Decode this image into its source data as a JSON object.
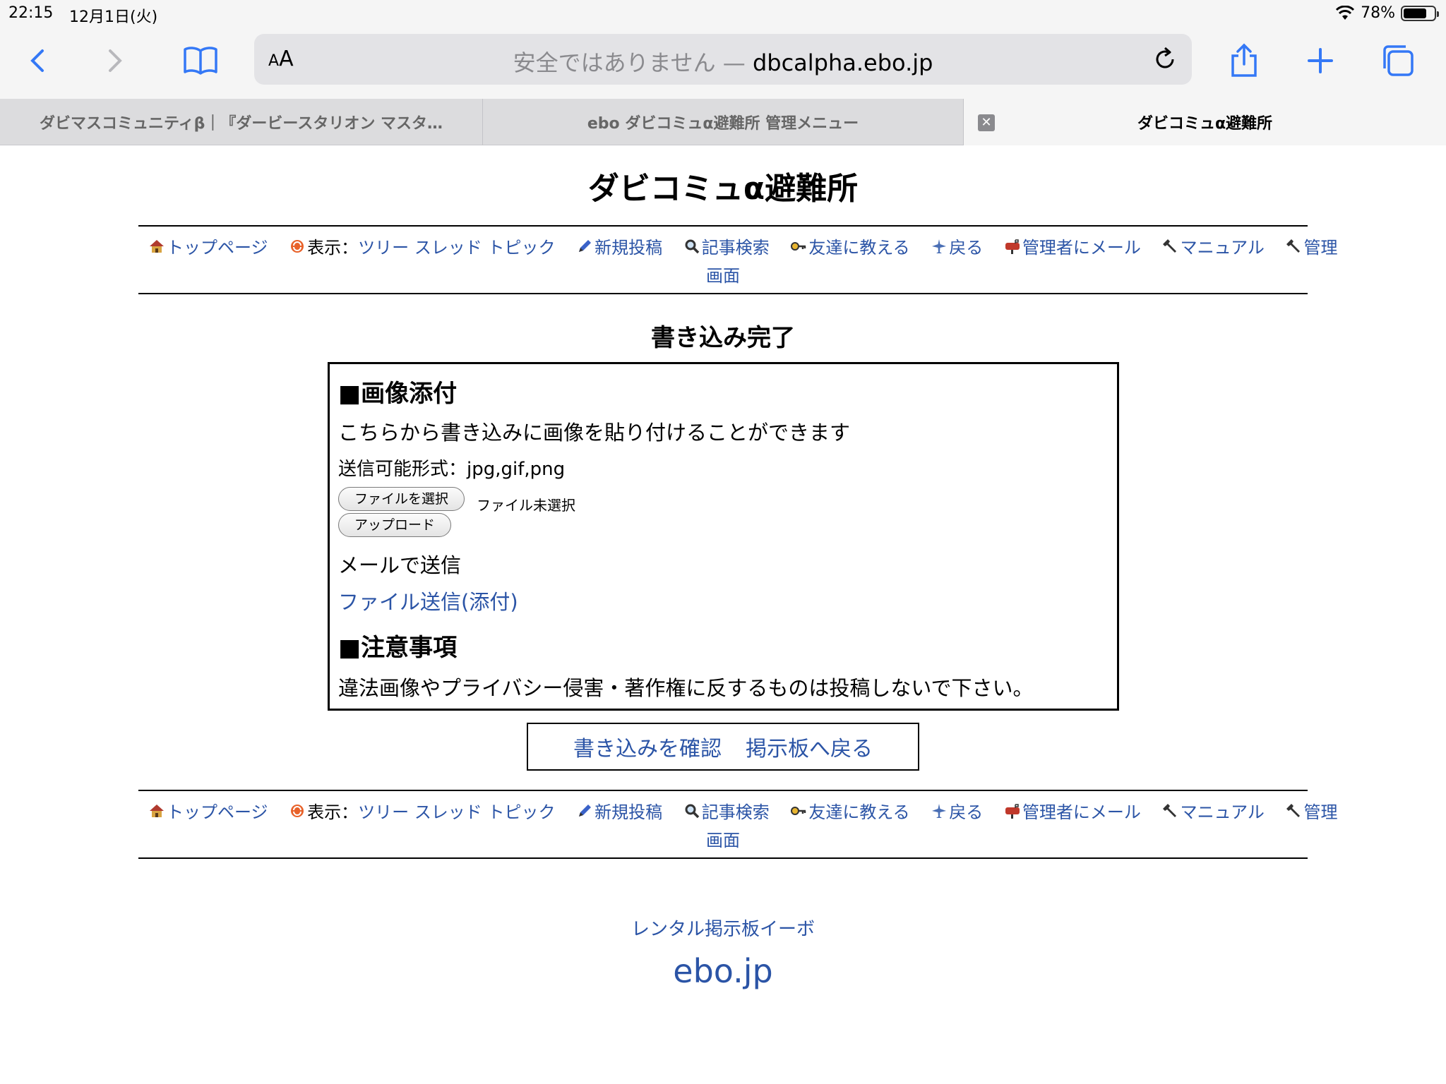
{
  "status_bar": {
    "time": "22:15",
    "date": "12月1日(火)",
    "battery": "78%",
    "battery_level": 0.78
  },
  "browser": {
    "text_size_label_small": "A",
    "text_size_label_large": "A",
    "address_insecure": "安全ではありません —",
    "address_host": "dbcalpha.ebo.jp",
    "tabs": [
      {
        "label": "ダビマスコミュニティβ｜『ダービースタリオン マスタ…"
      },
      {
        "label": "ebo ダビコミュα避難所 管理メニュー"
      },
      {
        "label": "ダビコミュα避難所",
        "close": "✕"
      }
    ]
  },
  "site_title": "ダビコミュα避難所",
  "nav": {
    "top": "トップページ",
    "view_prefix": "表示：",
    "tree": "ツリー",
    "thread": "スレッド",
    "topic": "トピック",
    "new_post": "新規投稿",
    "search": "記事検索",
    "tell_friend": "友達に教える",
    "back": "戻る",
    "mail_admin": "管理者にメール",
    "manual": "マニュアル",
    "admin": "管理",
    "admin_screen": "画面"
  },
  "done_title": "書き込み完了",
  "image_attach": {
    "heading": "■画像添付",
    "desc": "こちらから書き込みに画像を貼り付けることができます",
    "formats": "送信可能形式：jpg,gif,png",
    "choose_file": "ファイルを選択",
    "no_file": "ファイル未選択",
    "upload": "アップロード",
    "mail_heading": "メールで送信",
    "mail_link": "ファイル送信(添付)"
  },
  "notice": {
    "heading": "■注意事項",
    "text": "違法画像やプライバシー侵害・著作権に反するものは投稿しないで下さい。"
  },
  "confirm_links": {
    "confirm": "書き込みを確認",
    "back_board": "掲示板へ戻る"
  },
  "footer": {
    "rental": "レンタル掲示板イーボ",
    "domain": "ebo.jp"
  },
  "colors": {
    "link": "#2b54a6",
    "chrome_bg": "#f5f5f5",
    "accent": "#3478f6"
  }
}
